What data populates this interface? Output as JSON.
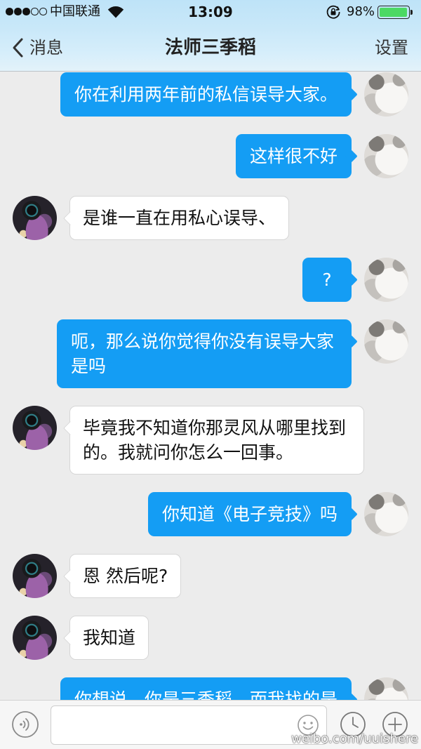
{
  "status_bar": {
    "signal_bars": 3,
    "signal_max": 5,
    "carrier": "中国联通",
    "time": "13:09",
    "battery_text": "98%",
    "battery_level": 0.98,
    "icons": {
      "wifi": "wifi-icon",
      "orientation_lock": "rotation-lock-icon",
      "battery": "battery-icon",
      "signal": "signal-dot"
    }
  },
  "nav": {
    "back_icon": "chevron-left-icon",
    "back_label": "消息",
    "title": "法师三季稻",
    "settings_label": "设置"
  },
  "avatars": {
    "me": "cat-avatar",
    "contact": "character-avatar"
  },
  "messages": [
    {
      "from": "me",
      "text": "你在利用两年前的私信误导大家。"
    },
    {
      "from": "me",
      "text": "这样很不好"
    },
    {
      "from": "contact",
      "text": "是谁一直在用私心误导、"
    },
    {
      "from": "me",
      "text": "?"
    },
    {
      "from": "me",
      "text": "呃，那么说你觉得你没有误导大家是吗"
    },
    {
      "from": "contact",
      "text": "毕竟我不知道你那灵风从哪里找到的。我就问你怎么一回事。"
    },
    {
      "from": "me",
      "text": "你知道《电子竞技》吗"
    },
    {
      "from": "contact",
      "text": "恩 然后呢?"
    },
    {
      "from": "contact",
      "text": "我知道"
    },
    {
      "from": "me",
      "text": "你想说，你是三季稻，而我找的是"
    }
  ],
  "composer": {
    "input_value": "",
    "input_placeholder": "",
    "icons": {
      "voice": "voice-icon",
      "emoji": "emoji-icon",
      "history": "clock-icon",
      "more": "plus-icon"
    }
  },
  "watermark": "weibo.com/uuishere",
  "colors": {
    "outgoing_bubble": "#149df4",
    "incoming_bubble": "#ffffff",
    "chat_background": "#ececec",
    "battery_fill": "#4cd964"
  }
}
